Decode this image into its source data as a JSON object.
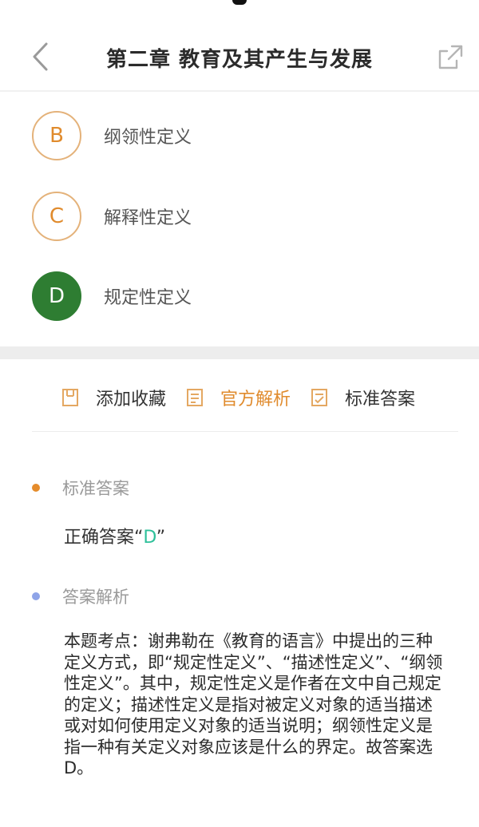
{
  "header": {
    "title": "第二章 教育及其产生与发展",
    "back_icon": "chevron-left-icon",
    "share_icon": "share-icon"
  },
  "options": [
    {
      "letter": "B",
      "text": "纲领性定义",
      "selected": false
    },
    {
      "letter": "C",
      "text": "解释性定义",
      "selected": false
    },
    {
      "letter": "D",
      "text": "规定性定义",
      "selected": true
    }
  ],
  "actions": {
    "favorite": "添加收藏",
    "official": "官方解析",
    "standard": "标准答案"
  },
  "standard_answer": {
    "label": "标准答案",
    "prefix": "正确答案“",
    "letter": "D",
    "suffix": "”"
  },
  "analysis": {
    "label": "答案解析",
    "text": "本题考点：谢弗勒在《教育的语言》中提出的三种定义方式，即“规定性定义”、“描述性定义”、“纲领性定义”。其中，规定性定义是作者在文中自己规定的定义；描述性定义是指对被定义对象的适当描述或对如何使用定义对象的适当说明；纲领性定义是指一种有关定义对象应该是什么的界定。故答案选D。"
  },
  "colors": {
    "accent": "#e08b2d",
    "selected": "#2e7d32",
    "answer_letter": "#2ec09a"
  }
}
